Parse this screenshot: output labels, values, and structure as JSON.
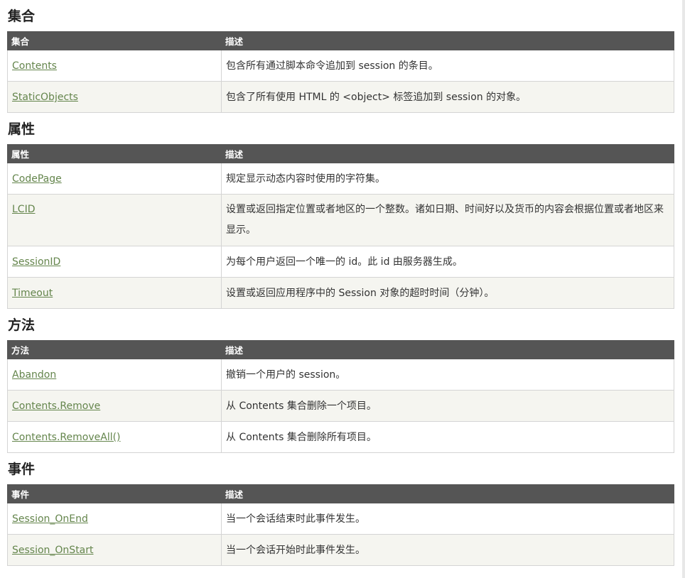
{
  "sections": [
    {
      "title": "集合",
      "headers": [
        "集合",
        "描述"
      ],
      "rows": [
        {
          "name": "Contents",
          "desc": "包含所有通过脚本命令追加到 session 的条目。"
        },
        {
          "name": "StaticObjects",
          "desc": "包含了所有使用 HTML 的 <object> 标签追加到 session 的对象。"
        }
      ]
    },
    {
      "title": "属性",
      "headers": [
        "属性",
        "描述"
      ],
      "rows": [
        {
          "name": "CodePage",
          "desc": "规定显示动态内容时使用的字符集。"
        },
        {
          "name": "LCID",
          "desc": "设置或返回指定位置或者地区的一个整数。诸如日期、时间好以及货币的内容会根据位置或者地区来显示。"
        },
        {
          "name": "SessionID",
          "desc": "为每个用户返回一个唯一的 id。此 id 由服务器生成。"
        },
        {
          "name": "Timeout",
          "desc": "设置或返回应用程序中的 Session 对象的超时时间（分钟）。"
        }
      ]
    },
    {
      "title": "方法",
      "headers": [
        "方法",
        "描述"
      ],
      "rows": [
        {
          "name": "Abandon",
          "desc": "撤销一个用户的 session。"
        },
        {
          "name": "Contents.Remove",
          "desc": "从 Contents 集合删除一个项目。"
        },
        {
          "name": "Contents.RemoveAll()",
          "desc": "从 Contents 集合删除所有项目。"
        }
      ]
    },
    {
      "title": "事件",
      "headers": [
        "事件",
        "描述"
      ],
      "rows": [
        {
          "name": "Session_OnEnd",
          "desc": "当一个会话结束时此事件发生。"
        },
        {
          "name": "Session_OnStart",
          "desc": "当一个会话开始时此事件发生。"
        }
      ]
    }
  ]
}
